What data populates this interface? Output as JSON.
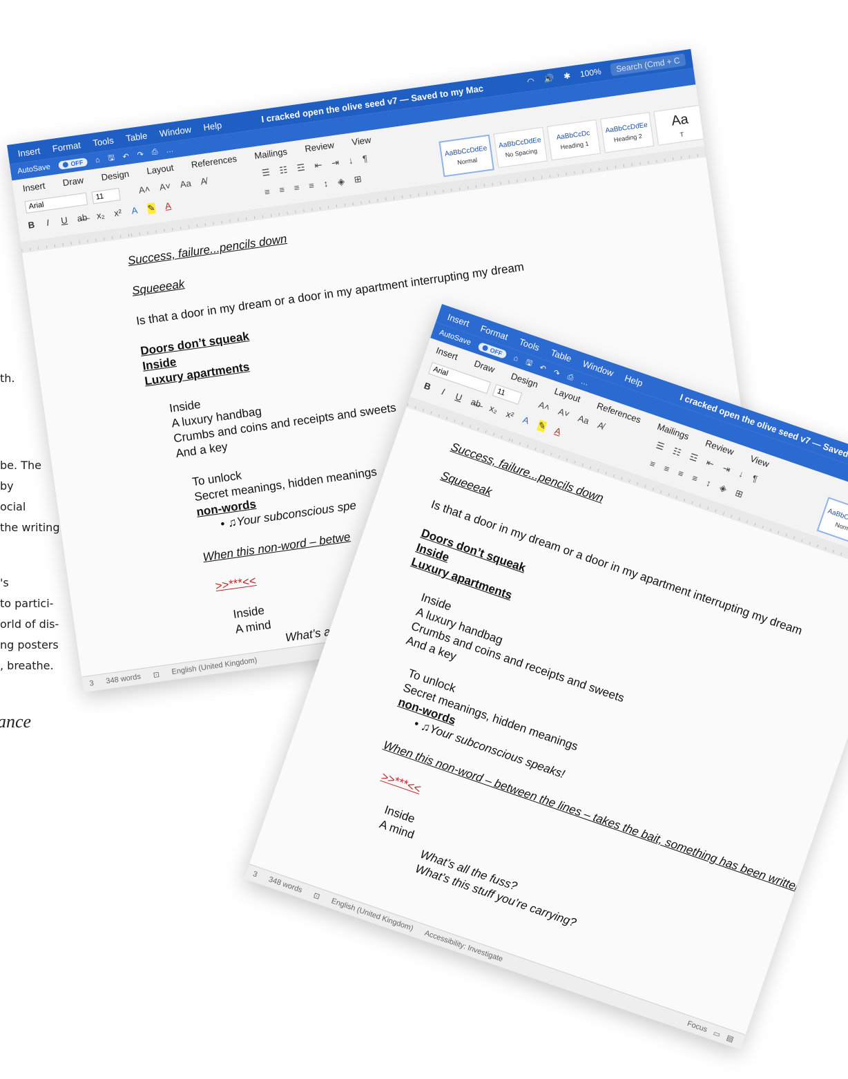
{
  "background": {
    "fragments": [
      "th.",
      "be. The",
      "by",
      "ocial",
      "the writing",
      "'s",
      "to partici-",
      "orld of dis-",
      "ng posters",
      ", breathe."
    ],
    "italic_fragment": "ance"
  },
  "window": {
    "menu": [
      "Insert",
      "Format",
      "Tools",
      "Table",
      "Window",
      "Help"
    ],
    "doc_title": "I cracked open the olive seed v7 — Saved to my Mac",
    "search_placeholder": "Search (Cmd + C",
    "battery": "100%",
    "autosave_label": "AutoSave",
    "autosave_state": "OFF",
    "tabs": [
      "Insert",
      "Draw",
      "Design",
      "Layout",
      "References",
      "Mailings",
      "Review",
      "View"
    ],
    "font_name": "Arial",
    "font_size": "11",
    "styles": [
      {
        "sample": "AaBbCcDdEe",
        "name": "Normal"
      },
      {
        "sample": "AaBbCcDdEe",
        "name": "No Spacing"
      },
      {
        "sample": "AaBbCcDc",
        "name": "Heading 1"
      },
      {
        "sample": "AaBbCcDdEe",
        "name": "Heading 2"
      },
      {
        "sample": "Aa",
        "name": "T"
      }
    ],
    "status": {
      "page": "3",
      "words": "348 words",
      "language": "English (United Kingdom)",
      "accessibility": "Accessibility: Investigate",
      "focus": "Focus"
    }
  },
  "document": {
    "line1": "Success, failure...pencils down",
    "line2": "Squeeeak",
    "line3": "Is that a door in my dream or a door in my apartment interrupting my dream",
    "line4": "Doors don’t squeak",
    "line5": "Inside",
    "line6": "Luxury apartments",
    "line7": "Inside",
    "line8": "A luxury handbag",
    "line9": "Crumbs and coins and receipts and sweets",
    "line10": "And a key",
    "line11": "To unlock",
    "line12": "Secret meanings, hidden meanings",
    "line13": "non-words",
    "line14": "• ♫Your subconscious speaks!",
    "line15": "When this non-word – between the lines – takes the bait, something has been written.",
    "line16": ">>***<<",
    "line17": "Inside",
    "line18": "A mind",
    "line19": "What’s all the fuss?",
    "line20": "What’s this stuff you’re carrying?"
  },
  "document_truncated": {
    "line14": "• ♫Your subconscious spe",
    "line15": "When this non-word – betwe",
    "line19": "What’s all t",
    "line20": "What’s th"
  },
  "colors": {
    "title_bar": "#1f5fc4",
    "ribbon": "#f3f3f3",
    "red_text": "#c0262b"
  }
}
